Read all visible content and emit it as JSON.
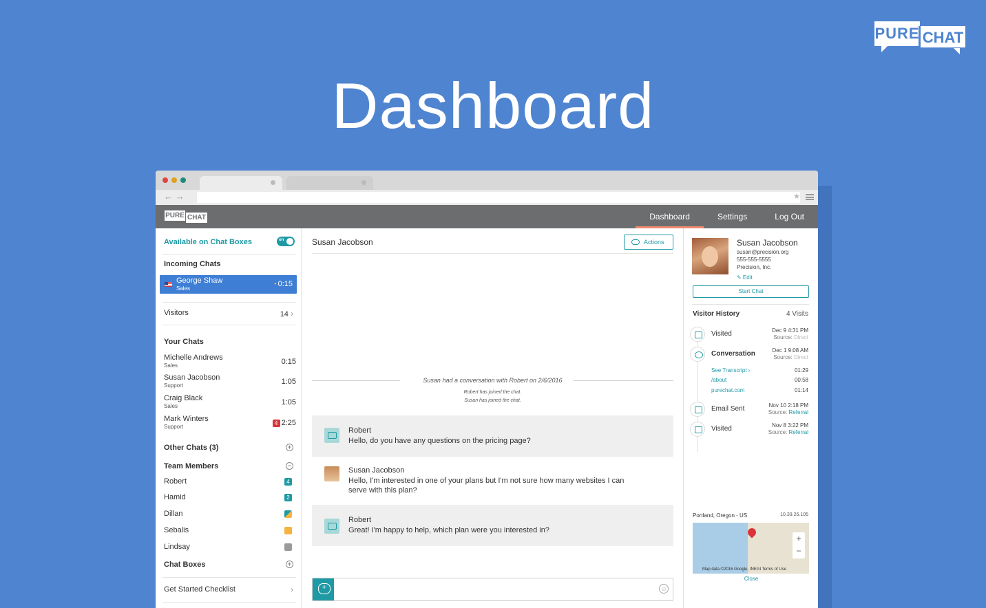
{
  "brand": {
    "logo_word1": "PURE",
    "logo_word2": "CHAT"
  },
  "page_title": "Dashboard",
  "app": {
    "logo_word1": "PURE",
    "logo_word2": "CHAT",
    "nav": [
      {
        "label": "Dashboard"
      },
      {
        "label": "Settings"
      },
      {
        "label": "Log Out"
      }
    ]
  },
  "sidebar": {
    "available_label": "Available on Chat Boxes",
    "toggle_state": "on",
    "incoming_heading": "Incoming Chats",
    "incoming_chat": {
      "name": "George Shaw",
      "department": "Sales",
      "time": "0:15"
    },
    "visitors_label": "Visitors",
    "visitors_count": "14",
    "your_chats_heading": "Your Chats",
    "your_chats": [
      {
        "name": "Michelle Andrews",
        "department": "Sales",
        "time": "0:15"
      },
      {
        "name": "Susan Jacobson",
        "department": "Support",
        "time": "1:05"
      },
      {
        "name": "Craig Black",
        "department": "Sales",
        "time": "1:05"
      },
      {
        "name": "Mark Winters",
        "department": "Support",
        "time": "2:25",
        "badge": "4"
      }
    ],
    "other_chats_label": "Other Chats (3)",
    "team_members_heading": "Team Members",
    "team_members": [
      {
        "name": "Robert",
        "badge": "4"
      },
      {
        "name": "Hamid",
        "badge": "2"
      },
      {
        "name": "Dillan",
        "badge": ""
      },
      {
        "name": "Sebalis",
        "badge": ""
      },
      {
        "name": "Lindsay",
        "badge": ""
      }
    ],
    "chat_boxes_label": "Chat Boxes",
    "checklist_label": "Get Started Checklist"
  },
  "conversation": {
    "visitor_name": "Susan Jacobson",
    "actions_label": "Actions",
    "history_note": "Susan had a conversation with Robert on 2/6/2016",
    "join_note_1": "Robert has joined the chat.",
    "join_note_2": "Susan has joined the chat.",
    "messages": [
      {
        "author": "Robert",
        "text": "Hello, do you have any questions on the pricing page?"
      },
      {
        "author": "Susan Jacobson",
        "text": "Hello, I'm interested in one of your plans but I'm not sure how many websites I can serve with this plan?"
      },
      {
        "author": "Robert",
        "text": "Great! I'm happy to help, which plan were you interested in?"
      }
    ],
    "composer_value": ""
  },
  "visitor": {
    "name": "Susan Jacobson",
    "email": "susan@precision.org",
    "phone": "555-555-5555",
    "company": "Precision, Inc.",
    "edit_label": "✎ Edit",
    "start_chat_label": "Start Chat",
    "history_title": "Visitor History",
    "visits_count": "4 Visits",
    "history": [
      {
        "label": "Visited",
        "date": "Dec 9 4:31 PM",
        "source_prefix": "Source:",
        "source": "Direct"
      },
      {
        "label": "Conversation",
        "date": "Dec 1 9:08 AM",
        "source_prefix": "Source:",
        "source": "Direct"
      },
      {
        "label": "Email Sent",
        "date": "Nov 10 2:18 PM",
        "source_prefix": "Source:",
        "source": "Referral"
      },
      {
        "label": "Visited",
        "date": "Nov 8 3:22 PM",
        "source_prefix": "Source:",
        "source": "Referral"
      }
    ],
    "transcript_items": [
      {
        "label": "See Transcript ›",
        "time": "01:29"
      },
      {
        "label": "/about",
        "time": "00:58"
      },
      {
        "label": "purechat.com",
        "time": "01:14"
      }
    ],
    "location": "Portland, Oregon - US",
    "ip": "10.39.26.105",
    "map_credit": "Map data ©2016 Google, INEGI  Terms of Use",
    "close_label": "Close"
  },
  "colors": {
    "background": "#4f84d0",
    "accent": "#1f9aa5",
    "header": "#6c6d6f",
    "active_tab_underline": "#f08a6e",
    "incoming_highlight": "#3e7ed4",
    "badge_red": "#d9343a"
  }
}
